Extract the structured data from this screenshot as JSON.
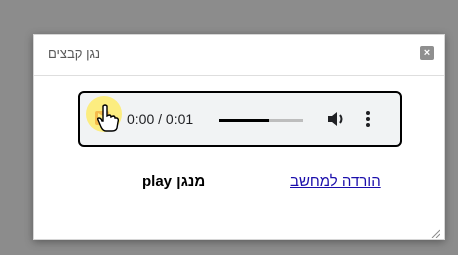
{
  "dialog": {
    "title": "נגן קבצים",
    "close_symbol": "×",
    "close_icon": "close-icon"
  },
  "audio_player": {
    "time_display": "0:00 / 0:01",
    "progress": 0.6,
    "play_icon": "play-icon",
    "volume_icon": "volume-icon",
    "more_icon": "more-options-icon"
  },
  "footer": {
    "download_link": "הורדה למחשב",
    "player_label": "מנגן play"
  },
  "colors": {
    "link": "#1a0dab",
    "play_button": "#d93025",
    "cursor_highlight": "#ffeb5a"
  }
}
